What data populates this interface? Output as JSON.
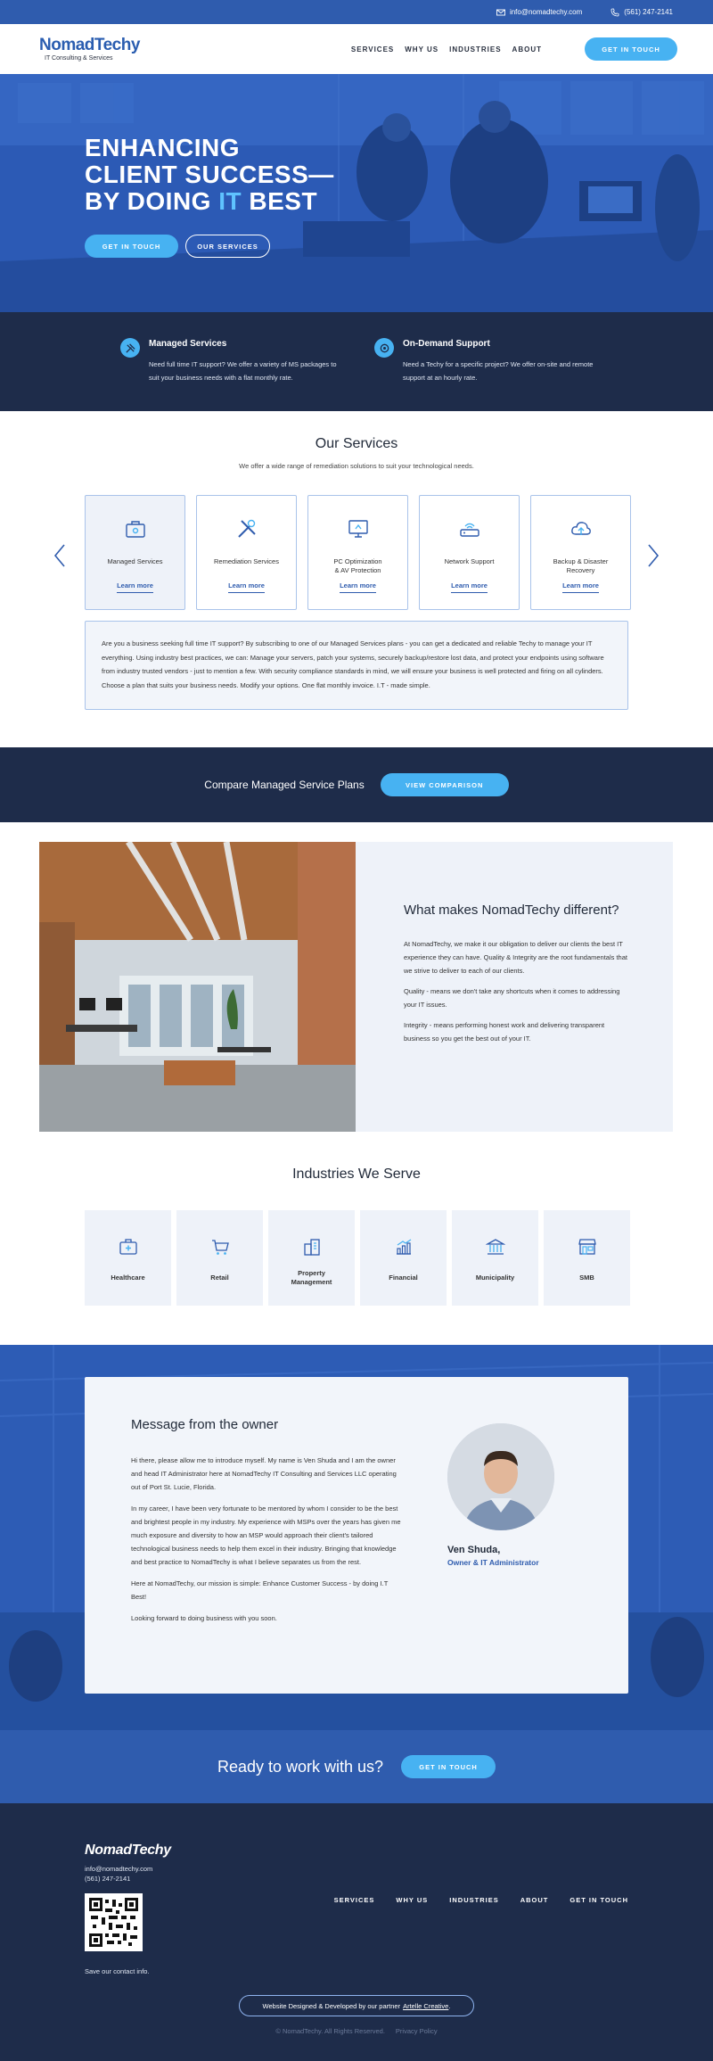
{
  "topbar": {
    "email": "info@nomadtechy.com",
    "phone": "(561) 247-2141"
  },
  "header": {
    "brand": "NomadTechy",
    "tagline": "IT Consulting & Services",
    "nav": [
      "SERVICES",
      "WHY US",
      "INDUSTRIES",
      "ABOUT"
    ],
    "cta": "GET IN TOUCH"
  },
  "hero": {
    "line1": "ENHANCING",
    "line2": "CLIENT SUCCESS—",
    "line3_pre": "BY DOING ",
    "line3_hl": "IT",
    "line3_post": " BEST",
    "cta_primary": "GET IN TOUCH",
    "cta_secondary": "OUR SERVICES"
  },
  "features": [
    {
      "icon": "tools-icon",
      "title": "Managed Services",
      "text": "Need full time IT support? We offer a variety of MS packages to suit your business needs with a flat monthly rate."
    },
    {
      "icon": "support-icon",
      "title": "On-Demand Support",
      "text": "Need a Techy for a specific project? We offer on-site and remote support at an hourly rate."
    }
  ],
  "services": {
    "title": "Our Services",
    "subtitle": "We offer a wide range of remediation solutions to suit your technological needs.",
    "learn_more": "Learn more",
    "cards": [
      {
        "icon": "briefcase-icon",
        "name": "Managed Services"
      },
      {
        "icon": "wrench-screwdriver-icon",
        "name": "Remediation Services"
      },
      {
        "icon": "monitor-icon",
        "name": "PC Optimization\n& AV Protection"
      },
      {
        "icon": "router-icon",
        "name": "Network Support"
      },
      {
        "icon": "cloud-backup-icon",
        "name": "Backup & Disaster\nRecovery"
      }
    ],
    "description": "Are you a business seeking full time IT support? By subscribing to one of our Managed Services plans - you can get a dedicated and reliable Techy to manage your IT everything. Using industry best practices, we can: Manage your servers, patch your systems, securely backup/restore lost data, and protect your endpoints using software from industry trusted vendors - just to mention a few. With security compliance standards in mind, we will ensure your business is well protected and firing on all cylinders. Choose a plan that suits your business needs. Modify your options. One flat monthly invoice. I.T - made simple."
  },
  "compare": {
    "text": "Compare Managed Service Plans",
    "cta": "VIEW COMPARISON"
  },
  "different": {
    "title": "What makes NomadTechy different?",
    "paragraphs": [
      "At NomadTechy, we make it our obligation to deliver our clients the best IT experience they can have. Quality & Integrity are the root fundamentals that we strive to deliver to each of our clients.",
      "Quality - means we don't take any shortcuts when it comes to addressing your IT issues.",
      "Integrity - means performing honest work and delivering transparent business so you get the best out of your IT."
    ]
  },
  "industries": {
    "title": "Industries We Serve",
    "items": [
      {
        "icon": "medical-kit-icon",
        "name": "Healthcare"
      },
      {
        "icon": "cart-icon",
        "name": "Retail"
      },
      {
        "icon": "buildings-icon",
        "name": "Property\nManagement"
      },
      {
        "icon": "chart-icon",
        "name": "Financial"
      },
      {
        "icon": "government-building-icon",
        "name": "Municipality"
      },
      {
        "icon": "storefront-icon",
        "name": "SMB"
      }
    ]
  },
  "owner": {
    "title": "Message from the owner",
    "paragraphs": [
      "Hi there, please allow me to introduce myself. My name is Ven Shuda and I am the owner and head IT Administrator here at NomadTechy IT Consulting and Services LLC operating out of Port St. Lucie, Florida.",
      "In my career, I have been very fortunate to be mentored by whom I consider to be the best and brightest people in my industry. My experience with MSPs over the years has given me much exposure and diversity to how an MSP would approach their client's tailored technological business needs to help them excel in their industry. Bringing that knowledge and best practice to NomadTechy is what I believe separates us from the rest.",
      "Here at NomadTechy, our mission is simple: Enhance Customer Success - by doing I.T Best!",
      "Looking forward to doing business with you soon."
    ],
    "name": "Ven Shuda,",
    "role": "Owner & IT Administrator"
  },
  "ready": {
    "text": "Ready to work with us?",
    "cta": "GET IN TOUCH"
  },
  "footer": {
    "brand": "NomadTechy",
    "email": "info@nomadtechy.com",
    "phone": "(561) 247-2141",
    "save": "Save our contact info.",
    "nav": [
      "SERVICES",
      "WHY US",
      "INDUSTRIES",
      "ABOUT",
      "GET IN TOUCH"
    ],
    "credit": "Website Designed & Developed by our partner",
    "credit_link": "Artelle Creative",
    "credit_end": ".",
    "copyright": "© NomadTechy. All Rights Reserved.",
    "privacy": "Privacy Policy"
  }
}
